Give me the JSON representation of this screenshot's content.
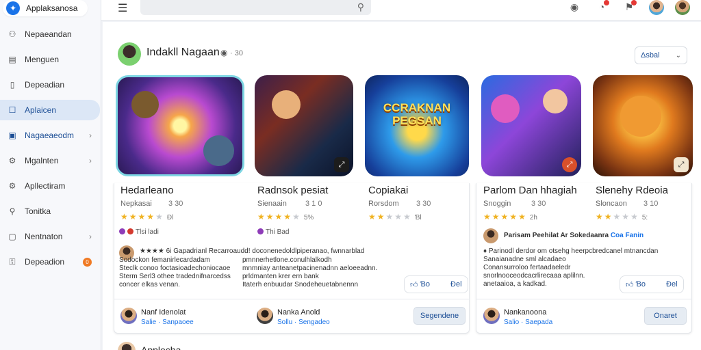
{
  "brand": {
    "name": "Applaksanosa"
  },
  "sidebar": {
    "items": [
      {
        "label": "Nepaeandan",
        "icon": "user-icon",
        "glyph": "⚇",
        "chevron": false,
        "badge": ""
      },
      {
        "label": "Menguen",
        "icon": "card-icon",
        "glyph": "▤",
        "chevron": false,
        "badge": ""
      },
      {
        "label": "Depeadian",
        "icon": "document-icon",
        "glyph": "▯",
        "chevron": false,
        "badge": ""
      },
      {
        "label": "Aplaicen",
        "icon": "app-icon",
        "glyph": "☐",
        "chevron": false,
        "badge": "",
        "active": true
      },
      {
        "label": "Nagaeaeodm",
        "icon": "doc-list-icon",
        "glyph": "▣",
        "chevron": true,
        "badge": "",
        "blue": true
      },
      {
        "label": "Mgalnten",
        "icon": "settings-icon",
        "glyph": "⚙",
        "chevron": true,
        "badge": ""
      },
      {
        "label": "Apllectiram",
        "icon": "gear-icon",
        "glyph": "⚙",
        "chevron": false,
        "badge": ""
      },
      {
        "label": "Tonitka",
        "icon": "person-icon",
        "glyph": "⚲",
        "chevron": false,
        "badge": ""
      },
      {
        "label": "Nentnaton",
        "icon": "page-icon",
        "glyph": "▢",
        "chevron": true,
        "badge": ""
      },
      {
        "label": "Depeadion",
        "icon": "bag-icon",
        "glyph": "⚿",
        "chevron": false,
        "badge": "0"
      }
    ]
  },
  "topbar": {
    "search_placeholder": ""
  },
  "developer": {
    "name": "Indakll Nagaan",
    "meta": "· 30",
    "follow_label": "Δsbal"
  },
  "cards": [
    {
      "title": "Hedarleano",
      "dev": "Nepkasai",
      "rating": "3 30",
      "stars_on": 4,
      "stars_off": 1,
      "stars_extra": "Ɖl"
    },
    {
      "title": "Radnsok pesiat",
      "dev": "Sienaain",
      "rating": "3 1 0",
      "stars_on": 4,
      "stars_off": 1,
      "stars_extra": "5%"
    },
    {
      "title": "Copiakai",
      "dev": "Rorsdom",
      "rating": "3 30",
      "stars_on": 2,
      "stars_off": 3,
      "stars_extra": "Ɓl"
    },
    {
      "title": "Parlom Dan hhagiah",
      "dev": "Snoggin",
      "rating": "3 30",
      "stars_on": 5,
      "stars_off": 0,
      "stars_extra": "2h"
    },
    {
      "title": "Slenehy Rdeoia",
      "dev": "Sloncaon",
      "rating": "3 10",
      "stars_on": 2,
      "stars_off": 3,
      "stars_extra": "5:"
    }
  ],
  "tile3_text": "CCRAKNAN PEGSAN",
  "review_a": {
    "mini1": "Tlsi ladi",
    "mini2": "Thi Bad",
    "head": "★★★★ 6i Gapadrianl  Recarroaudd! doconenedoldlpiperanao, fwnnarblad",
    "text_left": "Sodockon femanirlecardadam\nSteclk conoo foctasioadechoniocaoe\nSterm Serl3 othee tradednifnarcedss\nconcer elkas venan.",
    "text_right": "pmnnerhetlone.conulhlalkodh\nmnmniay anteanetpacinenadnn aeloeeadnn.\nprldmanten krer ern bank\nItaterh enbuudar Snodeheuetabnennn",
    "like": "Ɓo",
    "dislike": "Ɖel"
  },
  "review_b": {
    "head": "Parisam Peehilat Ar Sokedaanra",
    "head_link": "Coa Fanin",
    "text": "♦ Parinodl derdor om otsehg heerpcbredcanel mtnancdan\nSanaianadne sml alcadaeo\nConansurroloo fertaadaeledr\nsnorlnooceodcacrlirecaaa aplilnn.\nanetaaioa, a kadkad.",
    "like": "Ɓo",
    "dislike": "Ɖel"
  },
  "footer_a": [
    {
      "name": "Nanf Idenolat",
      "sub": "Salie · Sanpaoee"
    },
    {
      "name": "Nanka Anold",
      "sub": "Sollu · Sengadeo"
    }
  ],
  "footer_a_button": "Segendene",
  "footer_b": {
    "name": "Nankanoona",
    "sub": "Salio · Saepada"
  },
  "footer_b_button": "Onaret",
  "next_section": {
    "name": "Applecha"
  }
}
